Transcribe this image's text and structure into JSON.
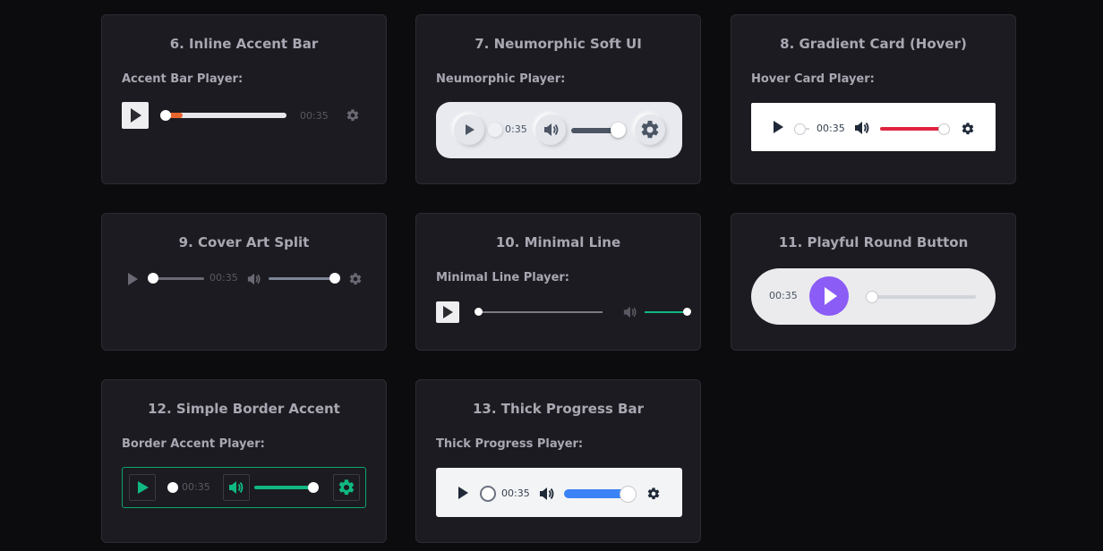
{
  "cards": [
    {
      "title": "6. Inline Accent Bar",
      "label": "Accent Bar Player:",
      "time": "00:35"
    },
    {
      "title": "7. Neumorphic Soft UI",
      "label": "Neumorphic Player:",
      "time": "0:35"
    },
    {
      "title": "8. Gradient Card (Hover)",
      "label": "Hover Card Player:",
      "time": "00:35"
    },
    {
      "title": "9. Cover Art Split",
      "label": "",
      "time": "00:35"
    },
    {
      "title": "10. Minimal Line",
      "label": "Minimal Line Player:",
      "time": ""
    },
    {
      "title": "11. Playful Round Button",
      "label": "",
      "time": "00:35"
    },
    {
      "title": "12. Simple Border Accent",
      "label": "Border Accent Player:",
      "time": "00:35"
    },
    {
      "title": "13. Thick Progress Bar",
      "label": "Thick Progress Player:",
      "time": "00:35"
    }
  ],
  "colors": {
    "accent_orange": "#e8662e",
    "hover_red": "#e0243e",
    "minimal_green": "#10b981",
    "border_green": "#10a36a",
    "playful_purple": "#8b5cf6",
    "thick_blue": "#3b82f6"
  },
  "icons": [
    "play-icon",
    "volume-icon",
    "gear-icon"
  ],
  "progress": {
    "accent": 0.04,
    "neumorphic_volume": 1.0,
    "hover_volume": 1.0,
    "cover_volume": 1.0,
    "minimal_volume": 1.0,
    "border_volume": 1.0,
    "thick_volume": 1.0
  }
}
